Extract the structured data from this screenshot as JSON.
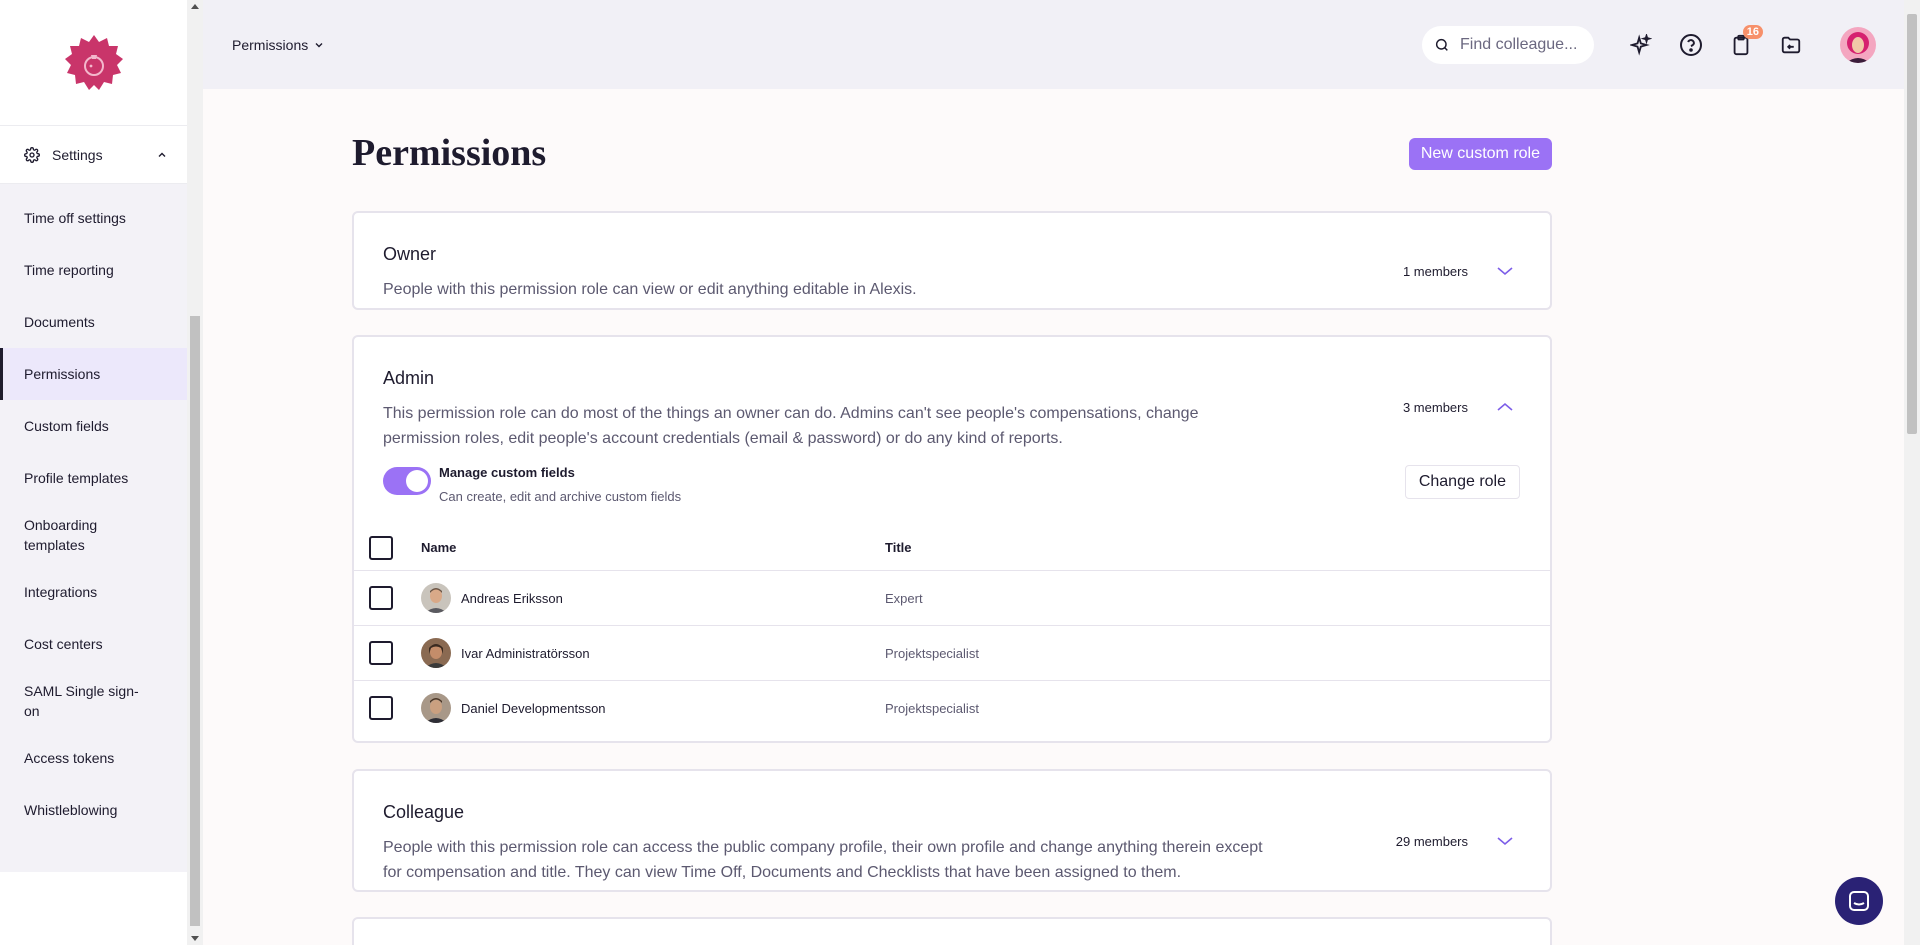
{
  "sidebar": {
    "settings_label": "Settings",
    "items": [
      {
        "label": "Time off settings"
      },
      {
        "label": "Time reporting"
      },
      {
        "label": "Documents"
      },
      {
        "label": "Permissions",
        "active": true
      },
      {
        "label": "Custom fields"
      },
      {
        "label": "Profile templates"
      },
      {
        "label": "Onboarding templates"
      },
      {
        "label": "Integrations"
      },
      {
        "label": "Cost centers"
      },
      {
        "label": "SAML Single sign-on"
      },
      {
        "label": "Access tokens"
      },
      {
        "label": "Whistleblowing"
      }
    ]
  },
  "topbar": {
    "breadcrumb": "Permissions",
    "search_placeholder": "Find colleague...",
    "notification_count": "16"
  },
  "page": {
    "title": "Permissions",
    "new_role_label": "New custom role"
  },
  "roles": {
    "owner": {
      "title": "Owner",
      "description": "People with this permission role can view or edit anything editable in Alexis.",
      "members": "1 members"
    },
    "admin": {
      "title": "Admin",
      "description": "This permission role can do most of the things an owner can do. Admins can't see people's compensations, change permission roles, edit people's account credentials (email & password) or do any kind of reports.",
      "members": "3 members",
      "toggle_title": "Manage custom fields",
      "toggle_desc": "Can create, edit and archive custom fields",
      "toggle_on": true,
      "change_role_label": "Change role",
      "columns": {
        "name": "Name",
        "title": "Title"
      },
      "rows": [
        {
          "name": "Andreas Eriksson",
          "title": "Expert"
        },
        {
          "name": "Ivar Administratörsson",
          "title": "Projektspecialist"
        },
        {
          "name": "Daniel Developmentsson",
          "title": "Projektspecialist"
        }
      ]
    },
    "colleague": {
      "title": "Colleague",
      "description": "People with this permission role can access the public company profile, their own profile and change anything therein except for compensation and title. They can view Time Off, Documents and Checklists that have been assigned to them.",
      "members": "29 members"
    }
  },
  "colors": {
    "accent": "#9b72f5",
    "brand_logo": "#c9356a",
    "badge": "#f7906a",
    "chat": "#2a2275"
  }
}
